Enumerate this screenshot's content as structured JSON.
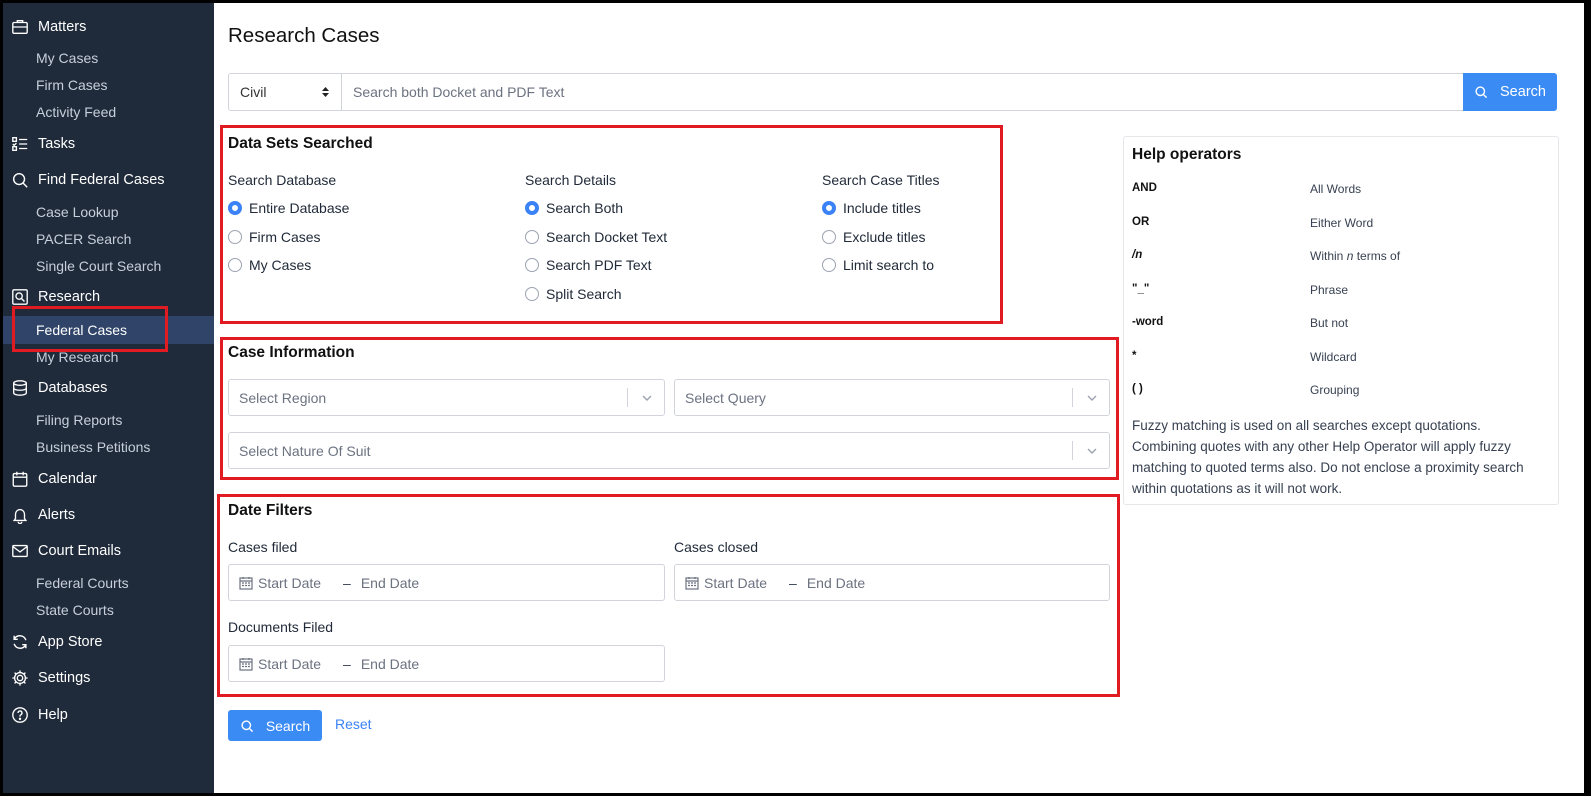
{
  "sidebar": {
    "matters": "Matters",
    "my_cases": "My Cases",
    "firm_cases": "Firm Cases",
    "activity_feed": "Activity Feed",
    "tasks": "Tasks",
    "find_federal_cases": "Find Federal Cases",
    "case_lookup": "Case Lookup",
    "pacer_search": "PACER Search",
    "single_court_search": "Single Court Search",
    "research": "Research",
    "federal_cases": "Federal Cases",
    "my_research": "My Research",
    "databases": "Databases",
    "filing_reports": "Filing Reports",
    "business_petitions": "Business Petitions",
    "calendar": "Calendar",
    "alerts": "Alerts",
    "court_emails": "Court Emails",
    "federal_courts": "Federal Courts",
    "state_courts": "State Courts",
    "app_store": "App Store",
    "settings": "Settings",
    "help": "Help"
  },
  "page": {
    "title": "Research Cases"
  },
  "search": {
    "type_value": "Civil",
    "placeholder": "Search both Docket and PDF Text",
    "button": "Search"
  },
  "datasets": {
    "title": "Data Sets Searched",
    "database": {
      "title": "Search Database",
      "options": [
        "Entire Database",
        "Firm Cases",
        "My Cases"
      ],
      "selected": "Entire Database"
    },
    "details": {
      "title": "Search Details",
      "options": [
        "Search Both",
        "Search Docket Text",
        "Search PDF Text",
        "Split Search"
      ],
      "selected": "Search Both"
    },
    "titles": {
      "title": "Search Case Titles",
      "options": [
        "Include titles",
        "Exclude titles",
        "Limit search to"
      ],
      "selected": "Include titles"
    }
  },
  "case_info": {
    "title": "Case Information",
    "region_placeholder": "Select Region",
    "query_placeholder": "Select Query",
    "nature_placeholder": "Select Nature Of Suit"
  },
  "date_filters": {
    "title": "Date Filters",
    "cases_filed": "Cases filed",
    "cases_closed": "Cases closed",
    "documents_filed": "Documents Filed",
    "start": "Start Date",
    "end": "End Date",
    "dash": "–"
  },
  "help": {
    "title": "Help operators",
    "operators": [
      {
        "op": "AND",
        "desc": "All Words"
      },
      {
        "op": "OR",
        "desc": "Either Word"
      },
      {
        "op": "/n",
        "desc_pre": "Within ",
        "desc_em": "n",
        "desc_post": " terms of"
      },
      {
        "op": "\"_\"",
        "desc": "Phrase"
      },
      {
        "op": "-word",
        "desc": "But not"
      },
      {
        "op": "*",
        "desc": "Wildcard"
      },
      {
        "op": "( )",
        "desc": "Grouping"
      }
    ],
    "note": "Fuzzy matching is used on all searches except quotations. Combining quotes with any other Help Operator will apply fuzzy matching to quoted terms also. Do not enclose a proximity search within quotations as it will not work."
  },
  "footer": {
    "search": "Search",
    "reset": "Reset"
  },
  "colors": {
    "sidebar_bg": "#1f2a3a",
    "accent": "#3b8bf5",
    "highlight": "#e01b22",
    "active_item": "#2f4468"
  }
}
